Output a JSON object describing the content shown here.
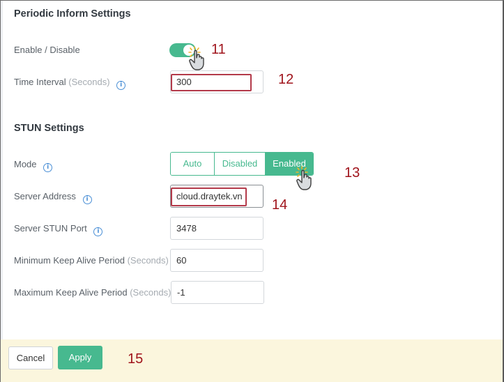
{
  "periodic": {
    "title": "Periodic Inform Settings",
    "enable_label": "Enable / Disable",
    "enabled": true,
    "interval_label": "Time Interval",
    "interval_unit": "(Seconds)",
    "interval_value": "300"
  },
  "stun": {
    "title": "STUN Settings",
    "mode_label": "Mode",
    "modes": [
      "Auto",
      "Disabled",
      "Enabled"
    ],
    "selected_mode": "Enabled",
    "server_address_label": "Server Address",
    "server_address_value": "cloud.draytek.vn",
    "stun_port_label": "Server STUN Port",
    "stun_port_value": "3478",
    "min_keepalive_label": "Minimum Keep Alive Period",
    "min_keepalive_unit": "(Seconds)",
    "min_keepalive_value": "60",
    "max_keepalive_label": "Maximum Keep Alive Period",
    "max_keepalive_unit": "(Seconds)",
    "max_keepalive_value": "-1"
  },
  "info_glyph": "i",
  "footer": {
    "cancel_label": "Cancel",
    "apply_label": "Apply"
  },
  "annotations": [
    "11",
    "12",
    "13",
    "14",
    "15"
  ],
  "colors": {
    "accent": "#47b98f",
    "annotation": "#a0141c",
    "highlight_box": "#b33a4a",
    "footer_bg": "#fbf6dd"
  },
  "icons": {
    "pointer": "hand-pointer-icon",
    "info": "info-icon"
  }
}
